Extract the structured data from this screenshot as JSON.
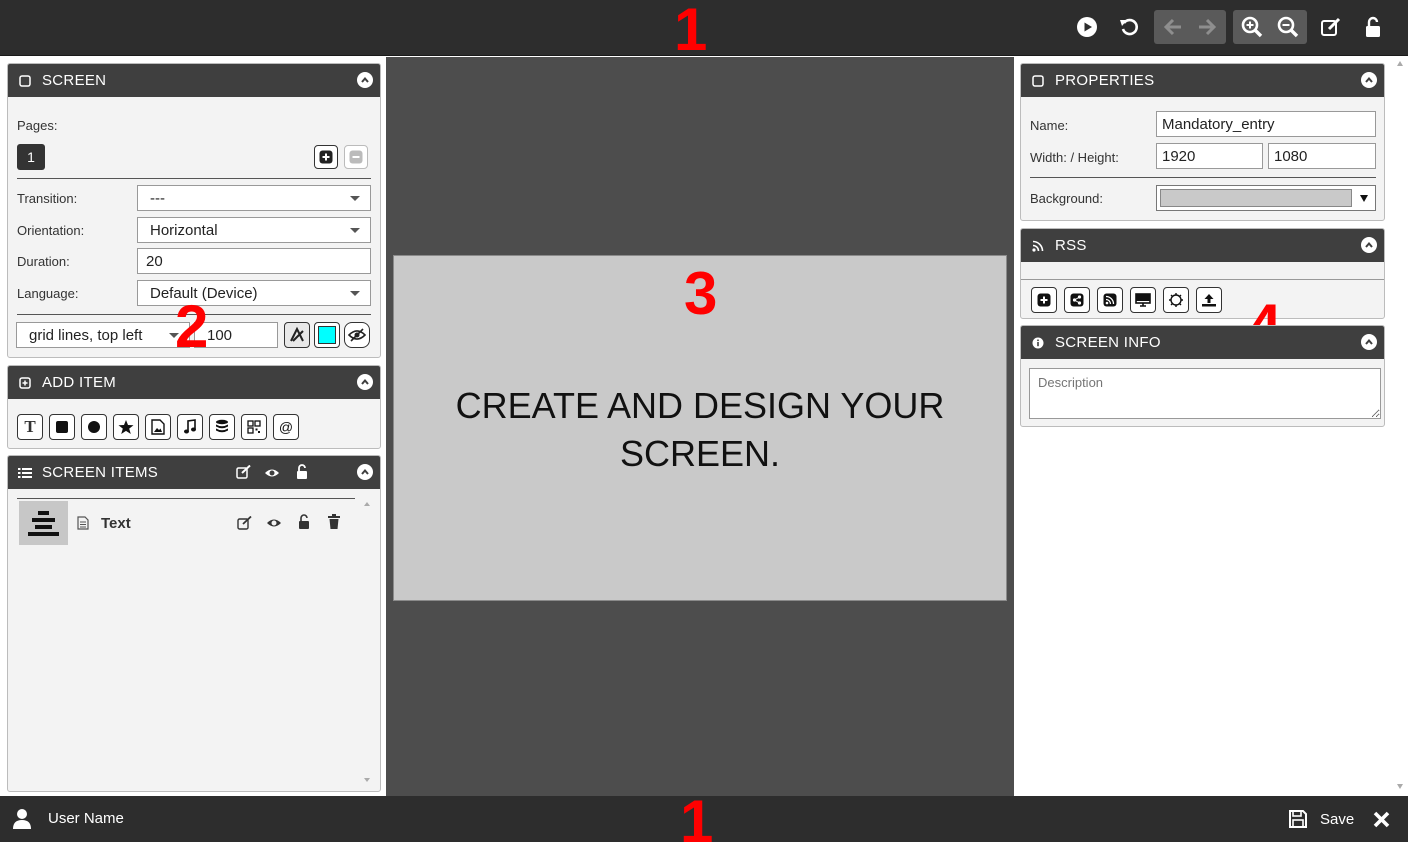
{
  "markers": {
    "top": "1",
    "left": "2",
    "center": "3",
    "right": "4",
    "bottom": "1"
  },
  "toolbar": {
    "icons": [
      "play-icon",
      "undo-icon",
      "arrow-left-icon",
      "arrow-right-icon",
      "zoom-in-icon",
      "zoom-out-icon",
      "edit-icon",
      "unlock-icon"
    ]
  },
  "screen_panel": {
    "title": "SCREEN",
    "pages_label": "Pages:",
    "page_number": "1",
    "transition_label": "Transition:",
    "transition_value": "---",
    "orientation_label": "Orientation:",
    "orientation_value": "Horizontal",
    "duration_label": "Duration:",
    "duration_value": "20",
    "language_label": "Language:",
    "language_value": "Default (Device)",
    "grid_value": "grid lines, top left",
    "grid_size": "100",
    "grid_color": "#00ffff"
  },
  "add_item_panel": {
    "title": "ADD ITEM",
    "buttons": [
      "text-icon",
      "square-icon",
      "circle-icon",
      "star-icon",
      "image-icon",
      "music-icon",
      "database-icon",
      "qr-code-icon",
      "at-icon"
    ]
  },
  "screen_items_panel": {
    "title": "SCREEN ITEMS",
    "items": [
      {
        "label": "Text"
      }
    ]
  },
  "canvas": {
    "line1": "CREATE AND DESIGN YOUR",
    "line2": "SCREEN."
  },
  "properties_panel": {
    "title": "PROPERTIES",
    "name_label": "Name:",
    "name_value": "Mandatory_entry",
    "size_label": "Width: / Height:",
    "width_value": "1920",
    "height_value": "1080",
    "background_label": "Background:",
    "background_color": "#c9c9c9"
  },
  "rss_panel": {
    "title": "RSS",
    "buttons": [
      "plus-icon",
      "share-icon",
      "rss-icon",
      "monitor-icon",
      "settings-icon",
      "upload-icon"
    ]
  },
  "screen_info_panel": {
    "title": "SCREEN INFO",
    "description_placeholder": "Description"
  },
  "footer": {
    "user_name": "User Name",
    "save_label": "Save"
  }
}
